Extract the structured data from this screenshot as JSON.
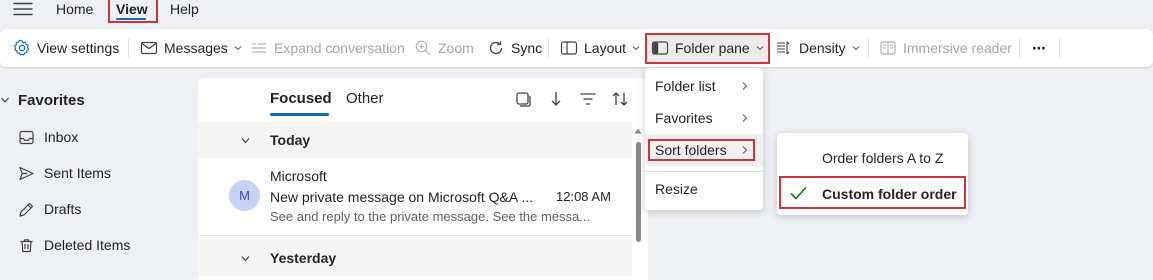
{
  "menubar": {
    "tabs": [
      {
        "label": "Home"
      },
      {
        "label": "View"
      },
      {
        "label": "Help"
      }
    ]
  },
  "ribbon": {
    "view_settings": "View settings",
    "messages": "Messages",
    "expand_conversation": "Expand conversation",
    "zoom": "Zoom",
    "sync": "Sync",
    "layout": "Layout",
    "folder_pane": "Folder pane",
    "density": "Density",
    "immersive_reader": "Immersive reader",
    "more": "⋯"
  },
  "sidebar": {
    "favorites_label": "Favorites",
    "items": [
      {
        "label": "Inbox",
        "icon": "inbox-icon"
      },
      {
        "label": "Sent Items",
        "icon": "send-icon"
      },
      {
        "label": "Drafts",
        "icon": "pencil-icon"
      },
      {
        "label": "Deleted Items",
        "icon": "trash-icon"
      }
    ]
  },
  "message_list": {
    "tabs": {
      "focused": "Focused",
      "other": "Other"
    },
    "groups": [
      {
        "label": "Today"
      },
      {
        "label": "Yesterday"
      }
    ],
    "messages": [
      {
        "avatar_initial": "M",
        "sender": "Microsoft",
        "subject": "New private message on Microsoft Q&A ...",
        "time": "12:08 AM",
        "preview": "See and reply to the private message. See the messa..."
      }
    ]
  },
  "folder_pane_menu": {
    "items": [
      {
        "label": "Folder list"
      },
      {
        "label": "Favorites"
      },
      {
        "label": "Sort folders"
      },
      {
        "label": "Resize"
      }
    ]
  },
  "sort_folders_menu": {
    "items": [
      {
        "label": "Order folders A to Z",
        "checked": false
      },
      {
        "label": "Custom folder order",
        "checked": true
      }
    ]
  },
  "colors": {
    "accent": "#0f6cbd",
    "highlight_border": "#d13438",
    "check_green": "#0e7a0d"
  }
}
